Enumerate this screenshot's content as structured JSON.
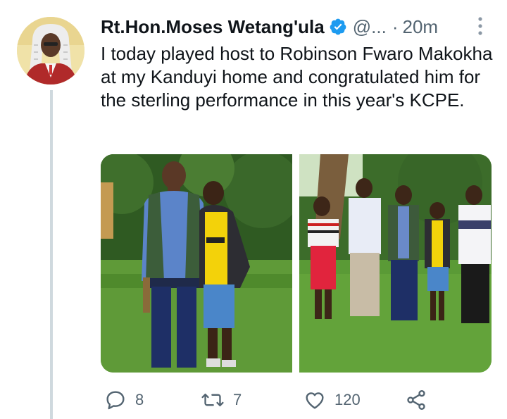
{
  "tweet": {
    "author_name": "Rt.Hon.Moses Wetang'ula",
    "handle": "@...",
    "separator": "·",
    "time": "20m",
    "text": "I today played host to Robinson Fwaro Makokha at my Kanduyi home and congratulated him for the sterling performance in this year's KCPE."
  },
  "actions": {
    "reply_count": "8",
    "retweet_count": "7",
    "like_count": "120"
  },
  "icons": {
    "verified": "verified-badge-icon",
    "more": "more-options-icon",
    "reply": "reply-icon",
    "retweet": "retweet-icon",
    "like": "heart-icon",
    "share": "share-icon"
  },
  "colors": {
    "text_primary": "#0f1419",
    "text_secondary": "#536471",
    "verified_blue": "#1d9bf0",
    "thread_line": "#cfd9de"
  }
}
